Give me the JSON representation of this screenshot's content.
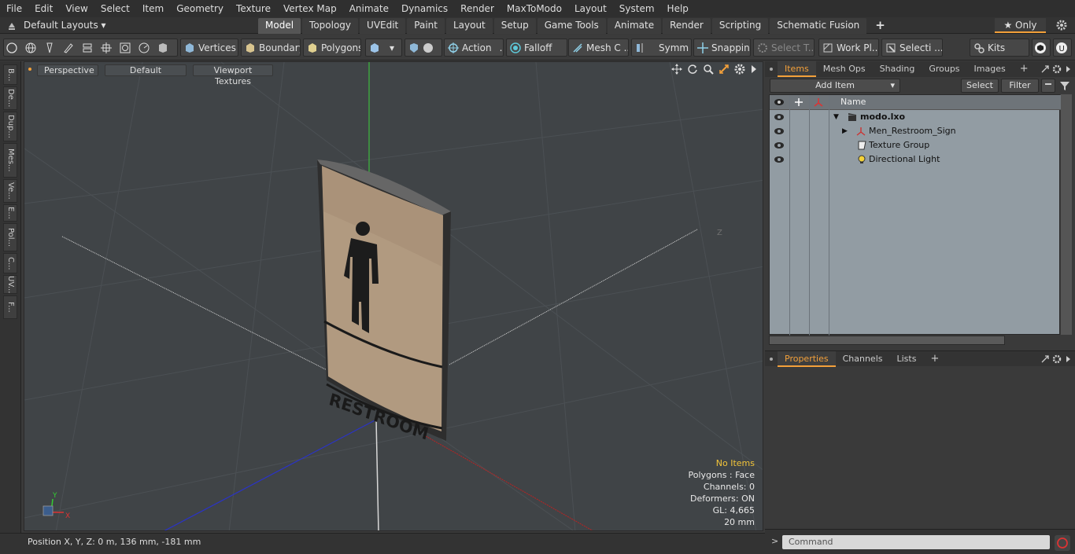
{
  "menu": [
    "File",
    "Edit",
    "View",
    "Select",
    "Item",
    "Geometry",
    "Texture",
    "Vertex Map",
    "Animate",
    "Dynamics",
    "Render",
    "MaxToModo",
    "Layout",
    "System",
    "Help"
  ],
  "layout_selector": "Default Layouts ▾",
  "workspace_tabs": [
    "Model",
    "Topology",
    "UVEdit",
    "Paint",
    "Layout",
    "Setup",
    "Game Tools",
    "Animate",
    "Render",
    "Scripting",
    "Schematic Fusion"
  ],
  "active_tab": "Model",
  "only_label": "★ Only",
  "toolbar": {
    "vertices": "Vertices",
    "boundary": "Boundary",
    "polygons": "Polygons",
    "action": "Action",
    "falloff": "Falloff",
    "mesh_c": "Mesh C ...",
    "symm": "Symm ...",
    "snapping": "Snapping",
    "select_t": "Select T...",
    "work_pl": "Work Pl...",
    "selecti": "Selecti ...",
    "kits": "Kits"
  },
  "left_tabs": [
    "B...",
    "De...",
    "Dup...",
    "Mes...",
    "Ve...",
    "E...",
    "Pol...",
    "C...",
    "UV...",
    "F..."
  ],
  "viewport": {
    "view_mode": "Perspective",
    "shading": "Default",
    "textures": "Viewport Textures",
    "sign_text": "RESTROOM",
    "axis_label": "Z",
    "stats": {
      "items": "No Items",
      "polygons": "Polygons : Face",
      "channels": "Channels: 0",
      "deformers": "Deformers: ON",
      "gl": "GL: 4,665",
      "scale": "20 mm"
    },
    "gizmo_y": "Y",
    "gizmo_x": "X"
  },
  "status": "Position X, Y, Z:   0 m, 136 mm, -181 mm",
  "items_panel": {
    "tabs": [
      "Items",
      "Mesh Ops",
      "Shading",
      "Groups",
      "Images"
    ],
    "add_item": "Add Item",
    "select": "Select",
    "filter": "Filter",
    "name_header": "Name",
    "rows": [
      {
        "name": "modo.lxo",
        "bold": true
      },
      {
        "name": "Men_Restroom_Sign",
        "bold": false
      },
      {
        "name": "Texture Group",
        "bold": false
      },
      {
        "name": "Directional Light",
        "bold": false
      }
    ]
  },
  "props_panel": {
    "tabs": [
      "Properties",
      "Channels",
      "Lists"
    ]
  },
  "command_placeholder": "Command",
  "colors": {
    "accent": "#f3a03a",
    "highlight": "#f3c53a"
  }
}
